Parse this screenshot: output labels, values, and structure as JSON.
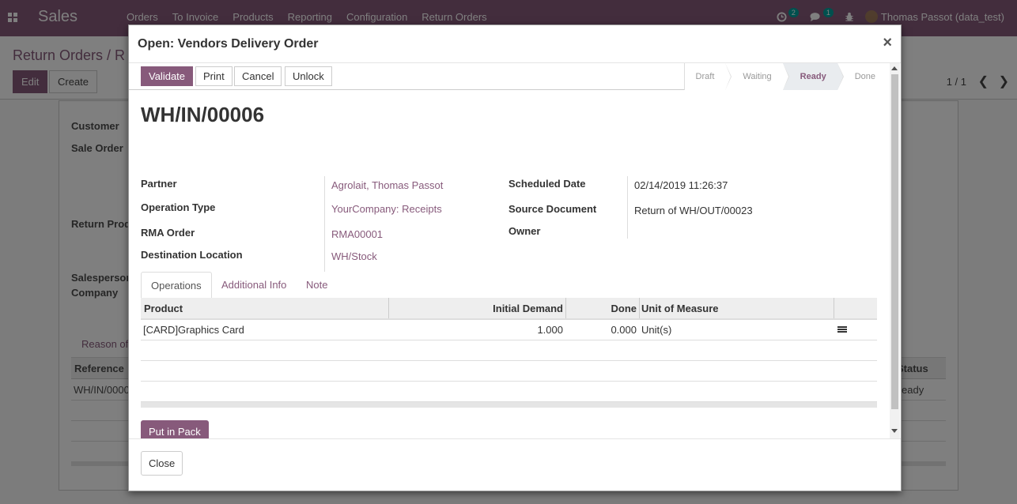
{
  "navbar": {
    "app_name": "Sales",
    "menu": [
      "Orders",
      "To Invoice",
      "Products",
      "Reporting",
      "Configuration",
      "Return Orders"
    ],
    "activity_count": "2",
    "message_count": "1",
    "user": "Thomas Passot (data_test)"
  },
  "control_panel": {
    "breadcrumb": "Return Orders / R",
    "edit_label": "Edit",
    "create_label": "Create",
    "pager": "1 / 1"
  },
  "background_form": {
    "customer_label": "Customer",
    "sale_order_label": "Sale Order",
    "return_prod_label": "Return Prod",
    "salesperson_label": "Salesperson",
    "company_label": "Company",
    "reason_tab": "Reason of",
    "reference_header": "Reference",
    "status_header": "Status",
    "row_reference": "WH/IN/0000",
    "row_status": "eady"
  },
  "modal": {
    "title": "Open: Vendors Delivery Order",
    "buttons": {
      "validate": "Validate",
      "print": "Print",
      "cancel": "Cancel",
      "unlock": "Unlock"
    },
    "stages": [
      {
        "label": "Draft",
        "current": false
      },
      {
        "label": "Waiting",
        "current": false
      },
      {
        "label": "Ready",
        "current": true
      },
      {
        "label": "Done",
        "current": false
      }
    ],
    "doc_name": "WH/IN/00006",
    "fields": {
      "partner_label": "Partner",
      "partner_value": "Agrolait, Thomas Passot",
      "operation_type_label": "Operation Type",
      "operation_type_value": "YourCompany: Receipts",
      "rma_order_label": "RMA Order",
      "rma_order_value": "RMA00001",
      "destination_label": "Destination Location",
      "destination_value": "WH/Stock",
      "scheduled_date_label": "Scheduled Date",
      "scheduled_date_value": "02/14/2019 11:26:37",
      "source_document_label": "Source Document",
      "source_document_value": "Return of WH/OUT/00023",
      "owner_label": "Owner"
    },
    "tabs": [
      "Operations",
      "Additional Info",
      "Note"
    ],
    "operations": {
      "headers": [
        "Product",
        "Initial Demand",
        "Done",
        "Unit of Measure"
      ],
      "rows": [
        {
          "product": "[CARD]Graphics Card",
          "initial_demand": "1.000",
          "done": "0.000",
          "uom": "Unit(s)"
        }
      ]
    },
    "put_in_pack_label": "Put in Pack",
    "close_label": "Close"
  },
  "colors": {
    "brand": "#875a7b",
    "badge": "#00a09d"
  }
}
